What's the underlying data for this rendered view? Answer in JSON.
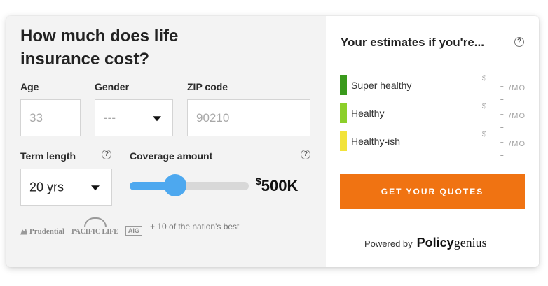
{
  "form": {
    "title": "How much does life insurance cost?",
    "age": {
      "label": "Age",
      "placeholder": "33"
    },
    "gender": {
      "label": "Gender",
      "value": "---"
    },
    "zip": {
      "label": "ZIP code",
      "placeholder": "90210"
    },
    "term": {
      "label": "Term length",
      "value": "20 yrs"
    },
    "coverage": {
      "label": "Coverage amount",
      "currency": "$",
      "value": "500K",
      "slider_fraction": 0.38
    },
    "insurers": [
      "Prudential",
      "PACIFIC LIFE",
      "AIG"
    ],
    "more_text": "+ 10 of the nation's best",
    "help_icon": "?"
  },
  "estimates": {
    "title": "Your estimates if you're...",
    "help_icon": "?",
    "rows": [
      {
        "label": "Super healthy",
        "currency": "$",
        "value": "--",
        "unit": "/MO",
        "color": "#3a9a1c"
      },
      {
        "label": "Healthy",
        "currency": "$",
        "value": "--",
        "unit": "/MO",
        "color": "#8ccf2a"
      },
      {
        "label": "Healthy-ish",
        "currency": "$",
        "value": "--",
        "unit": "/MO",
        "color": "#f2e33a"
      }
    ],
    "cta": "GET YOUR QUOTES",
    "powered_by": "Powered by",
    "brand_bold": "Policy",
    "brand_rest": "genius"
  },
  "colors": {
    "accent_orange": "#f07312",
    "slider_blue": "#4da8ef"
  }
}
